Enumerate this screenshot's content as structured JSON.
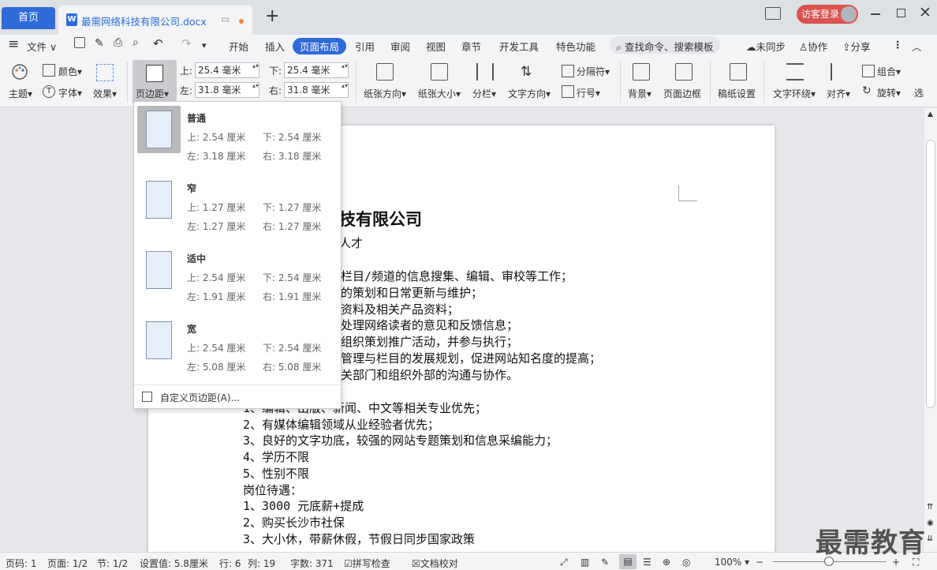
{
  "titlebar": {
    "home_tab": "首页",
    "doc_tab": "最需网络科技有限公司.docx",
    "add_tab": "+",
    "login": "访客登录"
  },
  "menu": {
    "file": "文件",
    "tabs": [
      "开始",
      "插入",
      "页面布局",
      "引用",
      "审阅",
      "视图",
      "章节",
      "开发工具",
      "特色功能"
    ],
    "active_tab": "页面布局",
    "search": "查找命令、搜索模板",
    "sync": "未同步",
    "collab": "协作",
    "share": "分享"
  },
  "ribbon": {
    "theme": "主题",
    "color": "颜色",
    "font": "字体",
    "effect": "效果",
    "margins": "页边距",
    "top_label": "上:",
    "top_value": "25.4 毫米",
    "left_label": "左:",
    "left_value": "31.8 毫米",
    "bottom_label": "下:",
    "bottom_value": "25.4 毫米",
    "right_label": "右:",
    "right_value": "31.8 毫米",
    "orientation": "纸张方向",
    "size": "纸张大小",
    "columns": "分栏",
    "text_direction": "文字方向",
    "breaks": "分隔符",
    "line_numbers": "行号",
    "background": "背景",
    "page_border": "页面边框",
    "grid_paper": "稿纸设置",
    "wrap": "文字环绕",
    "align": "对齐",
    "group": "组合",
    "rotate": "旋转",
    "select": "选"
  },
  "margins_menu": {
    "options": [
      {
        "name": "普通",
        "top": "上: 2.54 厘米",
        "bottom": "下: 2.54 厘米",
        "left": "左: 3.18 厘米",
        "right": "右: 3.18 厘米"
      },
      {
        "name": "窄",
        "top": "上: 1.27 厘米",
        "bottom": "下: 1.27 厘米",
        "left": "左: 1.27 厘米",
        "right": "右: 1.27 厘米"
      },
      {
        "name": "适中",
        "top": "上: 2.54 厘米",
        "bottom": "下: 2.54 厘米",
        "left": "左: 1.91 厘米",
        "right": "右: 1.91 厘米"
      },
      {
        "name": "宽",
        "top": "上: 2.54 厘米",
        "bottom": "下: 2.54 厘米",
        "left": "左: 5.08 厘米",
        "right": "右: 5.08 厘米"
      }
    ],
    "custom": "自定义页边距(A)..."
  },
  "document": {
    "title": "技有限公司",
    "subtitle": "人才",
    "lines": [
      "栏目/频道的信息搜集、编辑、审校等工作；",
      "的策划和日常更新与维护；",
      "资料及相关产品资料；",
      "处理网络读者的意见和反馈信息；",
      "组织策划推广活动，并参与执行；",
      "管理与栏目的发展规划，促进网站知名度的提高；",
      "关部门和组织外部的沟通与协作。"
    ],
    "lines2": [
      "1、编辑、出版、新闻、中文等相关专业优先；",
      "2、有媒体编辑领域从业经验者优先；",
      "3、良好的文字功底，较强的网站专题策划和信息采编能力；",
      "4、学历不限",
      "5、性别不限",
      "岗位待遇：",
      "1、3000 元底薪+提成",
      "2、购买长沙市社保",
      "3、大小休，带薪休假，节假日同步国家政策"
    ]
  },
  "status": {
    "page_code": "页码: 1",
    "pages": "页面: 1/2",
    "section": "节: 1/2",
    "setting": "设置值: 5.8厘米",
    "row": "行: 6",
    "col": "列: 19",
    "words": "字数: 371",
    "spell": "拼写检查",
    "proof": "文档校对",
    "zoom": "100%"
  },
  "watermark": "最需教育"
}
